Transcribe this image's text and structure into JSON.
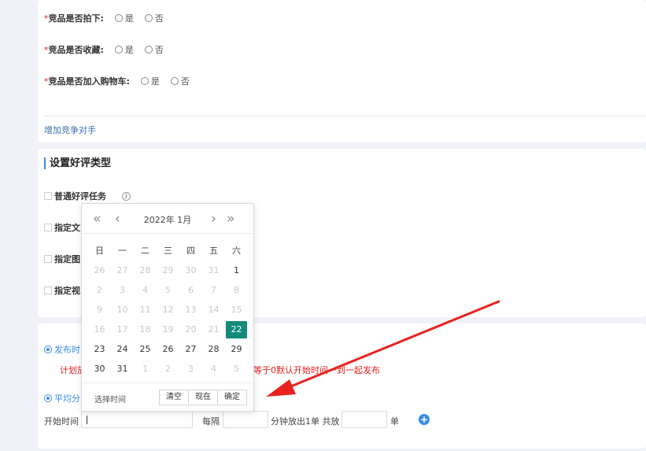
{
  "questions": [
    {
      "label": "竞品是否拍下:",
      "opt_yes": "是",
      "opt_no": "否"
    },
    {
      "label": "竞品是否收藏:",
      "opt_yes": "是",
      "opt_no": "否"
    },
    {
      "label": "竞品是否加入购物车:",
      "opt_yes": "是",
      "opt_no": "否"
    }
  ],
  "required_mark": "*",
  "add_competitor_link": "增加竞争对手",
  "review_section": {
    "title": "设置好评类型",
    "options": [
      "普通好评任务",
      "指定文",
      "指定图",
      "指定视"
    ]
  },
  "publish": {
    "option1": "发布时",
    "note_left": "计划放",
    "note_right": "等于0默认开始时间一到一起发布",
    "option2": "平均分",
    "start_label": "开始时间",
    "every_label": "每隔",
    "per_label": "分钟放出1单 共放",
    "unit_label": "单",
    "plus_icon": "plus-circle-icon"
  },
  "datepicker": {
    "title": "2022年  1月",
    "weekdays": [
      "日",
      "一",
      "二",
      "三",
      "四",
      "五",
      "六"
    ],
    "weeks": [
      [
        "26",
        "27",
        "28",
        "29",
        "30",
        "31",
        "1"
      ],
      [
        "2",
        "3",
        "4",
        "5",
        "6",
        "7",
        "8"
      ],
      [
        "9",
        "10",
        "11",
        "12",
        "13",
        "14",
        "15"
      ],
      [
        "16",
        "17",
        "18",
        "19",
        "20",
        "21",
        "22"
      ],
      [
        "23",
        "24",
        "25",
        "26",
        "27",
        "28",
        "29"
      ],
      [
        "30",
        "31",
        "1",
        "2",
        "3",
        "4",
        "5"
      ]
    ],
    "selected": "22",
    "footer_label": "选择时间",
    "btn_clear": "清空",
    "btn_now": "现在",
    "btn_ok": "确定"
  },
  "colors": {
    "accent": "#3a8ee6",
    "selected": "#138a7a",
    "required": "#e02020",
    "arrow": "#e8231f"
  }
}
